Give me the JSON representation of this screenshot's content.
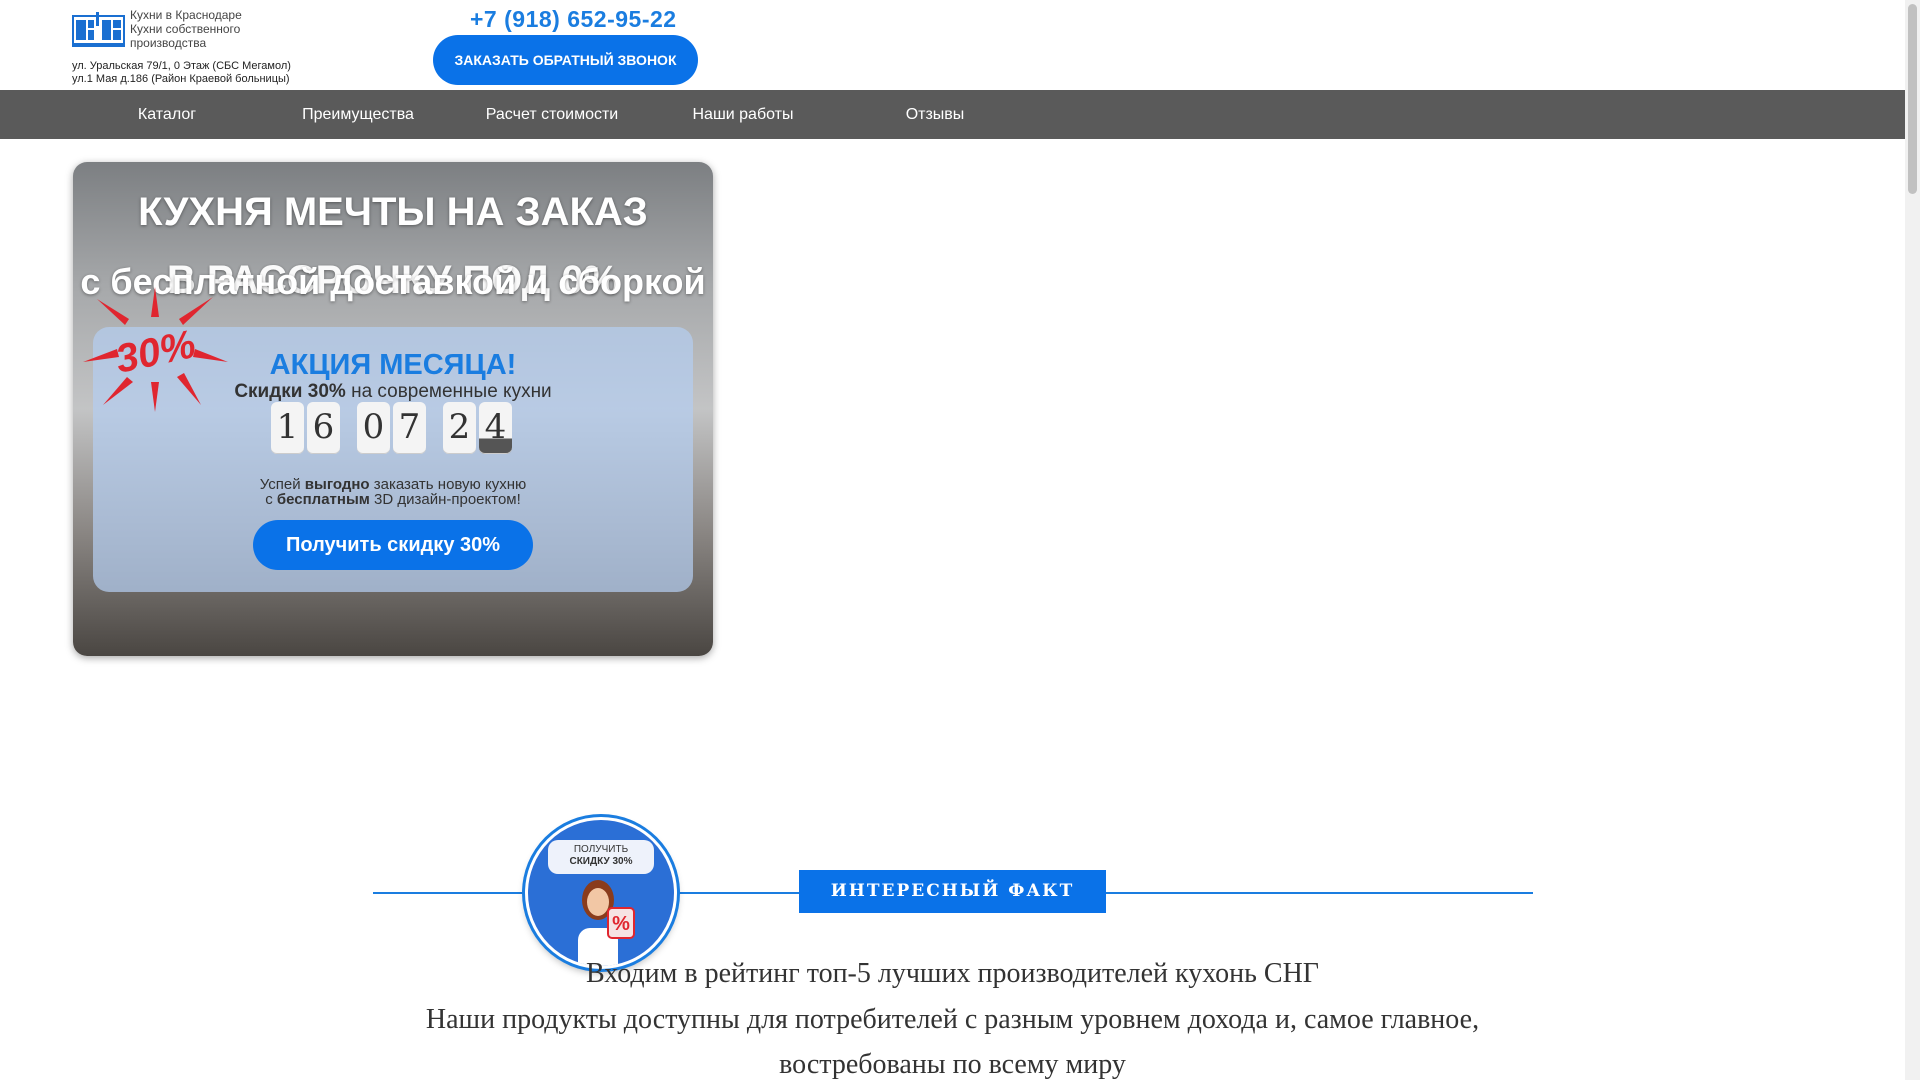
{
  "header": {
    "logo_lines": [
      "Кухни в Краснодаре",
      "Кухни собственного",
      "производства"
    ],
    "address_lines": [
      "ул. Уральская 79/1, 0 Этаж (СБС Мегамол)",
      "ул.1 Мая д.186 (Район Краевой больницы)"
    ],
    "phone": "+7 (918) 652-95-22",
    "callback_label": "ЗАКАЗАТЬ ОБРАТНЫЙ ЗВОНОК"
  },
  "nav": {
    "items": [
      {
        "label": "Каталог"
      },
      {
        "label": "Преимущества"
      },
      {
        "label": "Расчет стоимости"
      },
      {
        "label": "Наши работы"
      },
      {
        "label": "Отзывы"
      }
    ]
  },
  "hero": {
    "title_line1": "КУХНЯ МЕЧТЫ НА ЗАКАЗ",
    "title_line2": "с бесплатной доставкой и сборкой",
    "title_line3": "В РАССРОЧКУ ПОД 0%",
    "badge_text": "30%",
    "promo": {
      "heading": "АКЦИЯ МЕСЯЦА!",
      "sub_bold": "Скидки 30%",
      "sub_rest": " на современные кухни",
      "timer_digits": [
        "1",
        "6",
        "0",
        "7",
        "2",
        "4"
      ],
      "text_line1_a": "Успей ",
      "text_line1_b": "выгодно",
      "text_line1_c": " заказать новую кухню",
      "text_line2_a": "с ",
      "text_line2_b": "бесплатным",
      "text_line2_c": " 3D дизайн-проектом!",
      "button_label": "Получить скидку 30%"
    }
  },
  "fact": {
    "avatar_card_line1": "ПОЛУЧИТЬ",
    "avatar_card_line2": "СКИДКУ 30%",
    "badge": "ИНТЕРЕСНЫЙ ФАКТ",
    "line1": "Входим в рейтинг топ-5 лучших производителей кухонь СНГ",
    "line2": "Наши продукты доступны для потребителей с разным уровнем дохода и, самое главное,",
    "line3": "востребованы по всему миру"
  },
  "colors": {
    "accent": "#0a72e8",
    "nav_bg": "#5a5a5a",
    "badge_red": "#e0262f"
  }
}
